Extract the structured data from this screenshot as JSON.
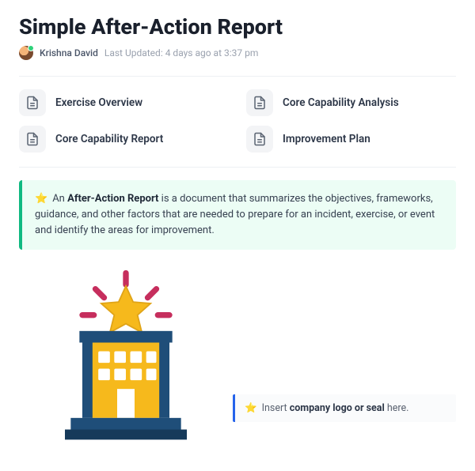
{
  "title": "Simple After-Action Report",
  "author": "Krishna David",
  "last_updated": "Last Updated: 4 days ago at 3:37 pm",
  "toc": {
    "items": [
      {
        "label": "Exercise Overview"
      },
      {
        "label": "Core Capability Analysis"
      },
      {
        "label": "Core Capability Report"
      },
      {
        "label": "Improvement Plan"
      }
    ]
  },
  "callout": {
    "icon": "⭐",
    "prefix": "An ",
    "bold": "After-Action Report",
    "rest": " is a document that summarizes the objectives, frameworks, guidance, and other factors that are needed to prepare for an incident, exercise, or event and identify the areas for improvement."
  },
  "hint": {
    "icon": "⭐",
    "prefix": "Insert ",
    "bold": "company logo or seal",
    "rest": " here."
  }
}
